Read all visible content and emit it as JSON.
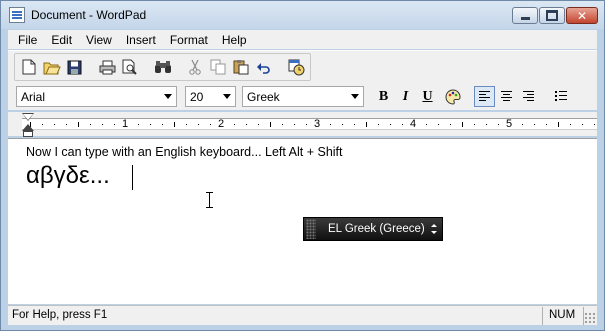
{
  "window": {
    "title": "Document - WordPad",
    "close_glyph": "✕"
  },
  "menu": {
    "items": [
      "File",
      "Edit",
      "View",
      "Insert",
      "Format",
      "Help"
    ]
  },
  "toolbar": {
    "icons": [
      "new-icon",
      "open-icon",
      "save-icon",
      "print-icon",
      "print-preview-icon",
      "find-icon",
      "cut-icon",
      "copy-icon",
      "paste-icon",
      "undo-icon",
      "insert-datetime-icon"
    ]
  },
  "format": {
    "font": "Arial",
    "size": "20",
    "script": "Greek",
    "bold": "B",
    "italic": "I",
    "underline": "U",
    "active_alignment": "left"
  },
  "ruler": {
    "numbers": [
      "1",
      "2",
      "3",
      "4",
      "5"
    ]
  },
  "document": {
    "line1": "Now I can type with an English keyboard... Left Alt + Shift",
    "line2": "αβγδε..."
  },
  "language_bar": {
    "label": "EL Greek (Greece)"
  },
  "status": {
    "help": "For Help, press F1",
    "num": "NUM"
  },
  "colors": {
    "frame": "#bcd0e6",
    "close_button": "#c1452e",
    "language_bar": "#101010"
  }
}
